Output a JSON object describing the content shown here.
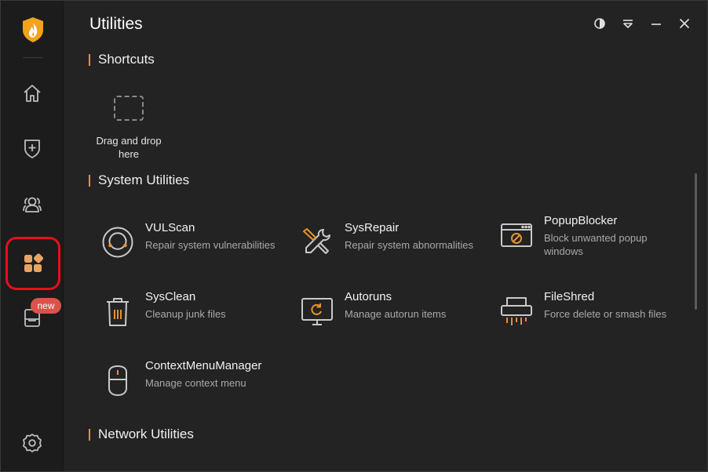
{
  "window": {
    "title": "Utilities"
  },
  "sidebar": {
    "logo_icon": "shield-flame-logo",
    "items": [
      {
        "id": "home",
        "icon": "home-icon"
      },
      {
        "id": "protection",
        "icon": "shield-plus-icon"
      },
      {
        "id": "accounts",
        "icon": "users-icon"
      },
      {
        "id": "utilities",
        "icon": "apps-icon",
        "active": true
      },
      {
        "id": "store",
        "icon": "box-icon",
        "badge": "new"
      },
      {
        "id": "settings",
        "icon": "gear-icon"
      }
    ]
  },
  "controls": [
    "theme-icon",
    "menu-icon",
    "minimize-icon",
    "close-icon"
  ],
  "sections": {
    "shortcuts": "Shortcuts",
    "system": "System Utilities",
    "network": "Network Utilities"
  },
  "dropzone": {
    "line1": "Drag and drop",
    "line2": "here"
  },
  "tools": [
    {
      "name": "VULScan",
      "desc": "Repair system vulnerabilities",
      "icon": "scan-icon"
    },
    {
      "name": "SysRepair",
      "desc": "Repair system abnormalities",
      "icon": "tools-icon"
    },
    {
      "name": "PopupBlocker",
      "desc": "Block unwanted popup windows",
      "icon": "popup-block-icon"
    },
    {
      "name": "SysClean",
      "desc": "Cleanup junk files",
      "icon": "trash-icon"
    },
    {
      "name": "Autoruns",
      "desc": "Manage autorun items",
      "icon": "monitor-refresh-icon"
    },
    {
      "name": "FileShred",
      "desc": "Force delete or smash files",
      "icon": "shredder-icon"
    },
    {
      "name": "ContextMenuManager",
      "desc": "Manage context menu",
      "icon": "mouse-icon"
    }
  ],
  "colors": {
    "accent": "#e8912d",
    "highlight": "#e3101c",
    "badge": "#d9534b",
    "background": "#232323"
  }
}
